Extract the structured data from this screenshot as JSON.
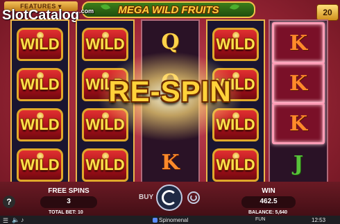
{
  "header": {
    "features_label": "FEATURES",
    "watermark": "SlotCatalog",
    "watermark_suffix": ".com",
    "game_title": "MEGA WILD FRUITS",
    "lines_badge": "20"
  },
  "reels": {
    "wild_label": "WILD",
    "reel3_symbols": [
      "Q",
      "Q",
      "K"
    ],
    "reel5_symbols": [
      "K",
      "K",
      "K",
      "J"
    ]
  },
  "overlay": {
    "respin_text": "RE-SPIN"
  },
  "footer": {
    "free_spins_label": "FREE SPINS",
    "free_spins_value": "3",
    "buy_label": "BUY",
    "win_label": "WIN",
    "win_value": "462.5",
    "total_bet": "TOTAL BET: 10",
    "balance": "BALANCE: 5,640",
    "brand": "Spinomenal",
    "mode": "FUN",
    "clock": "12:53",
    "help_label": "?"
  },
  "colors": {
    "accent_gold": "#ffd23c",
    "frame_pink": "#ff9cb6",
    "bg_red": "#9e2738"
  }
}
